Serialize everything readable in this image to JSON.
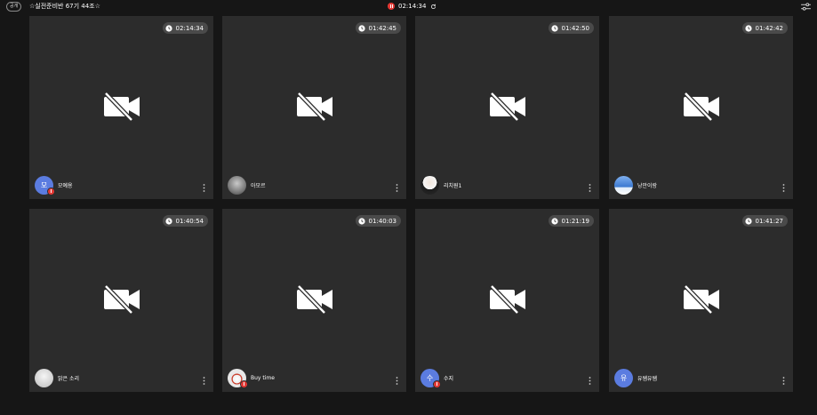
{
  "header": {
    "visibility_badge": "공개",
    "room_title": "☆실전준비반 67기 44조☆",
    "session_timer": "02:14:34",
    "colors": {
      "live": "#e53935",
      "avatar_default": "#5b7ce0"
    }
  },
  "tiles": [
    {
      "time": "02:14:34",
      "name": "모예용",
      "avatar_text": "모",
      "muted": true
    },
    {
      "time": "01:42:45",
      "name": "아모르",
      "avatar_text": "",
      "muted": false
    },
    {
      "time": "01:42:50",
      "name": "리치원1",
      "avatar_text": "",
      "muted": false
    },
    {
      "time": "01:42:42",
      "name": "낭만이랑",
      "avatar_text": "",
      "muted": false
    },
    {
      "time": "01:40:54",
      "name": "맑은 소리",
      "avatar_text": "",
      "muted": false
    },
    {
      "time": "01:40:03",
      "name": "Buy time",
      "avatar_text": "",
      "muted": true
    },
    {
      "time": "01:21:19",
      "name": "수지",
      "avatar_text": "수",
      "muted": true
    },
    {
      "time": "01:41:27",
      "name": "유쌤유쌤",
      "avatar_text": "유",
      "muted": false
    }
  ]
}
